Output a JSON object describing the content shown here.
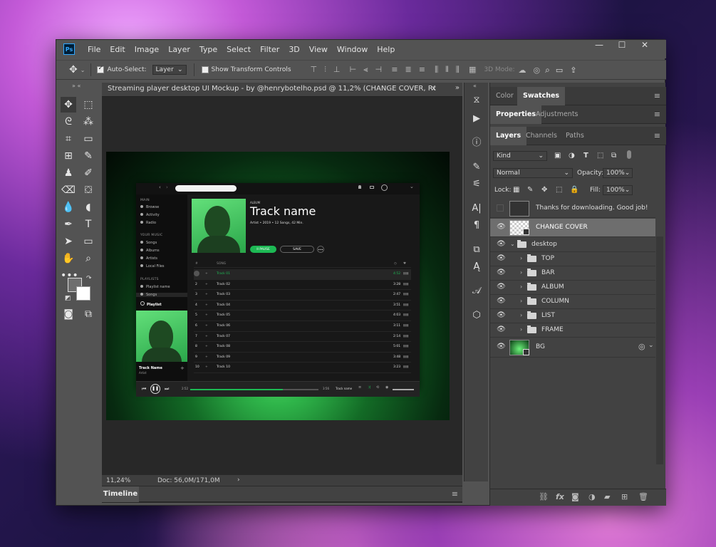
{
  "app": {
    "logo": "Ps",
    "menus": [
      "File",
      "Edit",
      "Image",
      "Layer",
      "Type",
      "Select",
      "Filter",
      "3D",
      "View",
      "Window",
      "Help"
    ],
    "window_controls": [
      "—",
      "☐",
      "✕"
    ]
  },
  "options_bar": {
    "auto_select_label": "Auto-Select:",
    "auto_select_value": "Layer",
    "show_transform_label": "Show Transform Controls",
    "mode_3d_label": "3D Mode:"
  },
  "document": {
    "tab_title": "Streaming player desktop UI Mockup - by @henrybotelho.psd @ 11,2% (CHANGE COVER, RGB/8...",
    "zoom": "11,24%",
    "doc_size": "Doc: 56,0M/171,0M",
    "timeline_tab": "Timeline"
  },
  "mockup": {
    "sidebar": {
      "main_header": "MAIN",
      "main_items": [
        "Browse",
        "Activity",
        "Radio"
      ],
      "music_header": "YOUR MUSIC",
      "music_items": [
        "Songs",
        "Albums",
        "Artists",
        "Local Files"
      ],
      "playlists_header": "PLAYLISTS",
      "playlist_items": [
        "Playlist name",
        "Songs"
      ],
      "new_playlist": "Playlist",
      "now_playing_title": "Track Name",
      "now_playing_artist": "Artist"
    },
    "hero": {
      "type": "ALBUM",
      "title": "Track name",
      "subtitle": "Artist • 2019 • 12 Songs, 42 Min.",
      "pause_label": "II PAUSE",
      "save_label": "SAVE",
      "more_label": "•••"
    },
    "track_header": {
      "num": "#",
      "song": "SONG"
    },
    "tracks": [
      {
        "n": "",
        "name": "Track 01",
        "time": "4:52"
      },
      {
        "n": "2",
        "name": "Track 02",
        "time": "3:28"
      },
      {
        "n": "3",
        "name": "Track 03",
        "time": "2:47"
      },
      {
        "n": "4",
        "name": "Track 04",
        "time": "3:51"
      },
      {
        "n": "5",
        "name": "Track 05",
        "time": "4:03"
      },
      {
        "n": "6",
        "name": "Track 06",
        "time": "3:11"
      },
      {
        "n": "7",
        "name": "Track 07",
        "time": "2:14"
      },
      {
        "n": "8",
        "name": "Track 08",
        "time": "5:01"
      },
      {
        "n": "9",
        "name": "Track 09",
        "time": "3:48"
      },
      {
        "n": "10",
        "name": "Track 10",
        "time": "3:23"
      }
    ],
    "player": {
      "elapsed": "2:52",
      "total": "3:56",
      "track_label": "Track name",
      "progress": 0.72
    }
  },
  "panels": {
    "color_tabs": [
      "Color",
      "Swatches"
    ],
    "prop_tabs": [
      "Properties",
      "Adjustments"
    ],
    "layer_tabs": [
      "Layers",
      "Channels",
      "Paths"
    ],
    "filter_kind": "Kind",
    "blend_mode": "Normal",
    "opacity_label": "Opacity:",
    "opacity_value": "100%",
    "lock_label": "Lock:",
    "fill_label": "Fill:",
    "fill_value": "100%",
    "layers": {
      "thanks": "Thanks for downloading. Good job!",
      "change_cover": "CHANGE COVER",
      "desktop": "desktop",
      "groups": [
        "TOP",
        "BAR",
        "ALBUM",
        "COLUMN",
        "LIST",
        "FRAME"
      ],
      "bg": "BG"
    }
  },
  "colors": {
    "accent": "#1db954",
    "ps_blue": "#31a8ff",
    "selected_layer": "#6e6e6e"
  }
}
